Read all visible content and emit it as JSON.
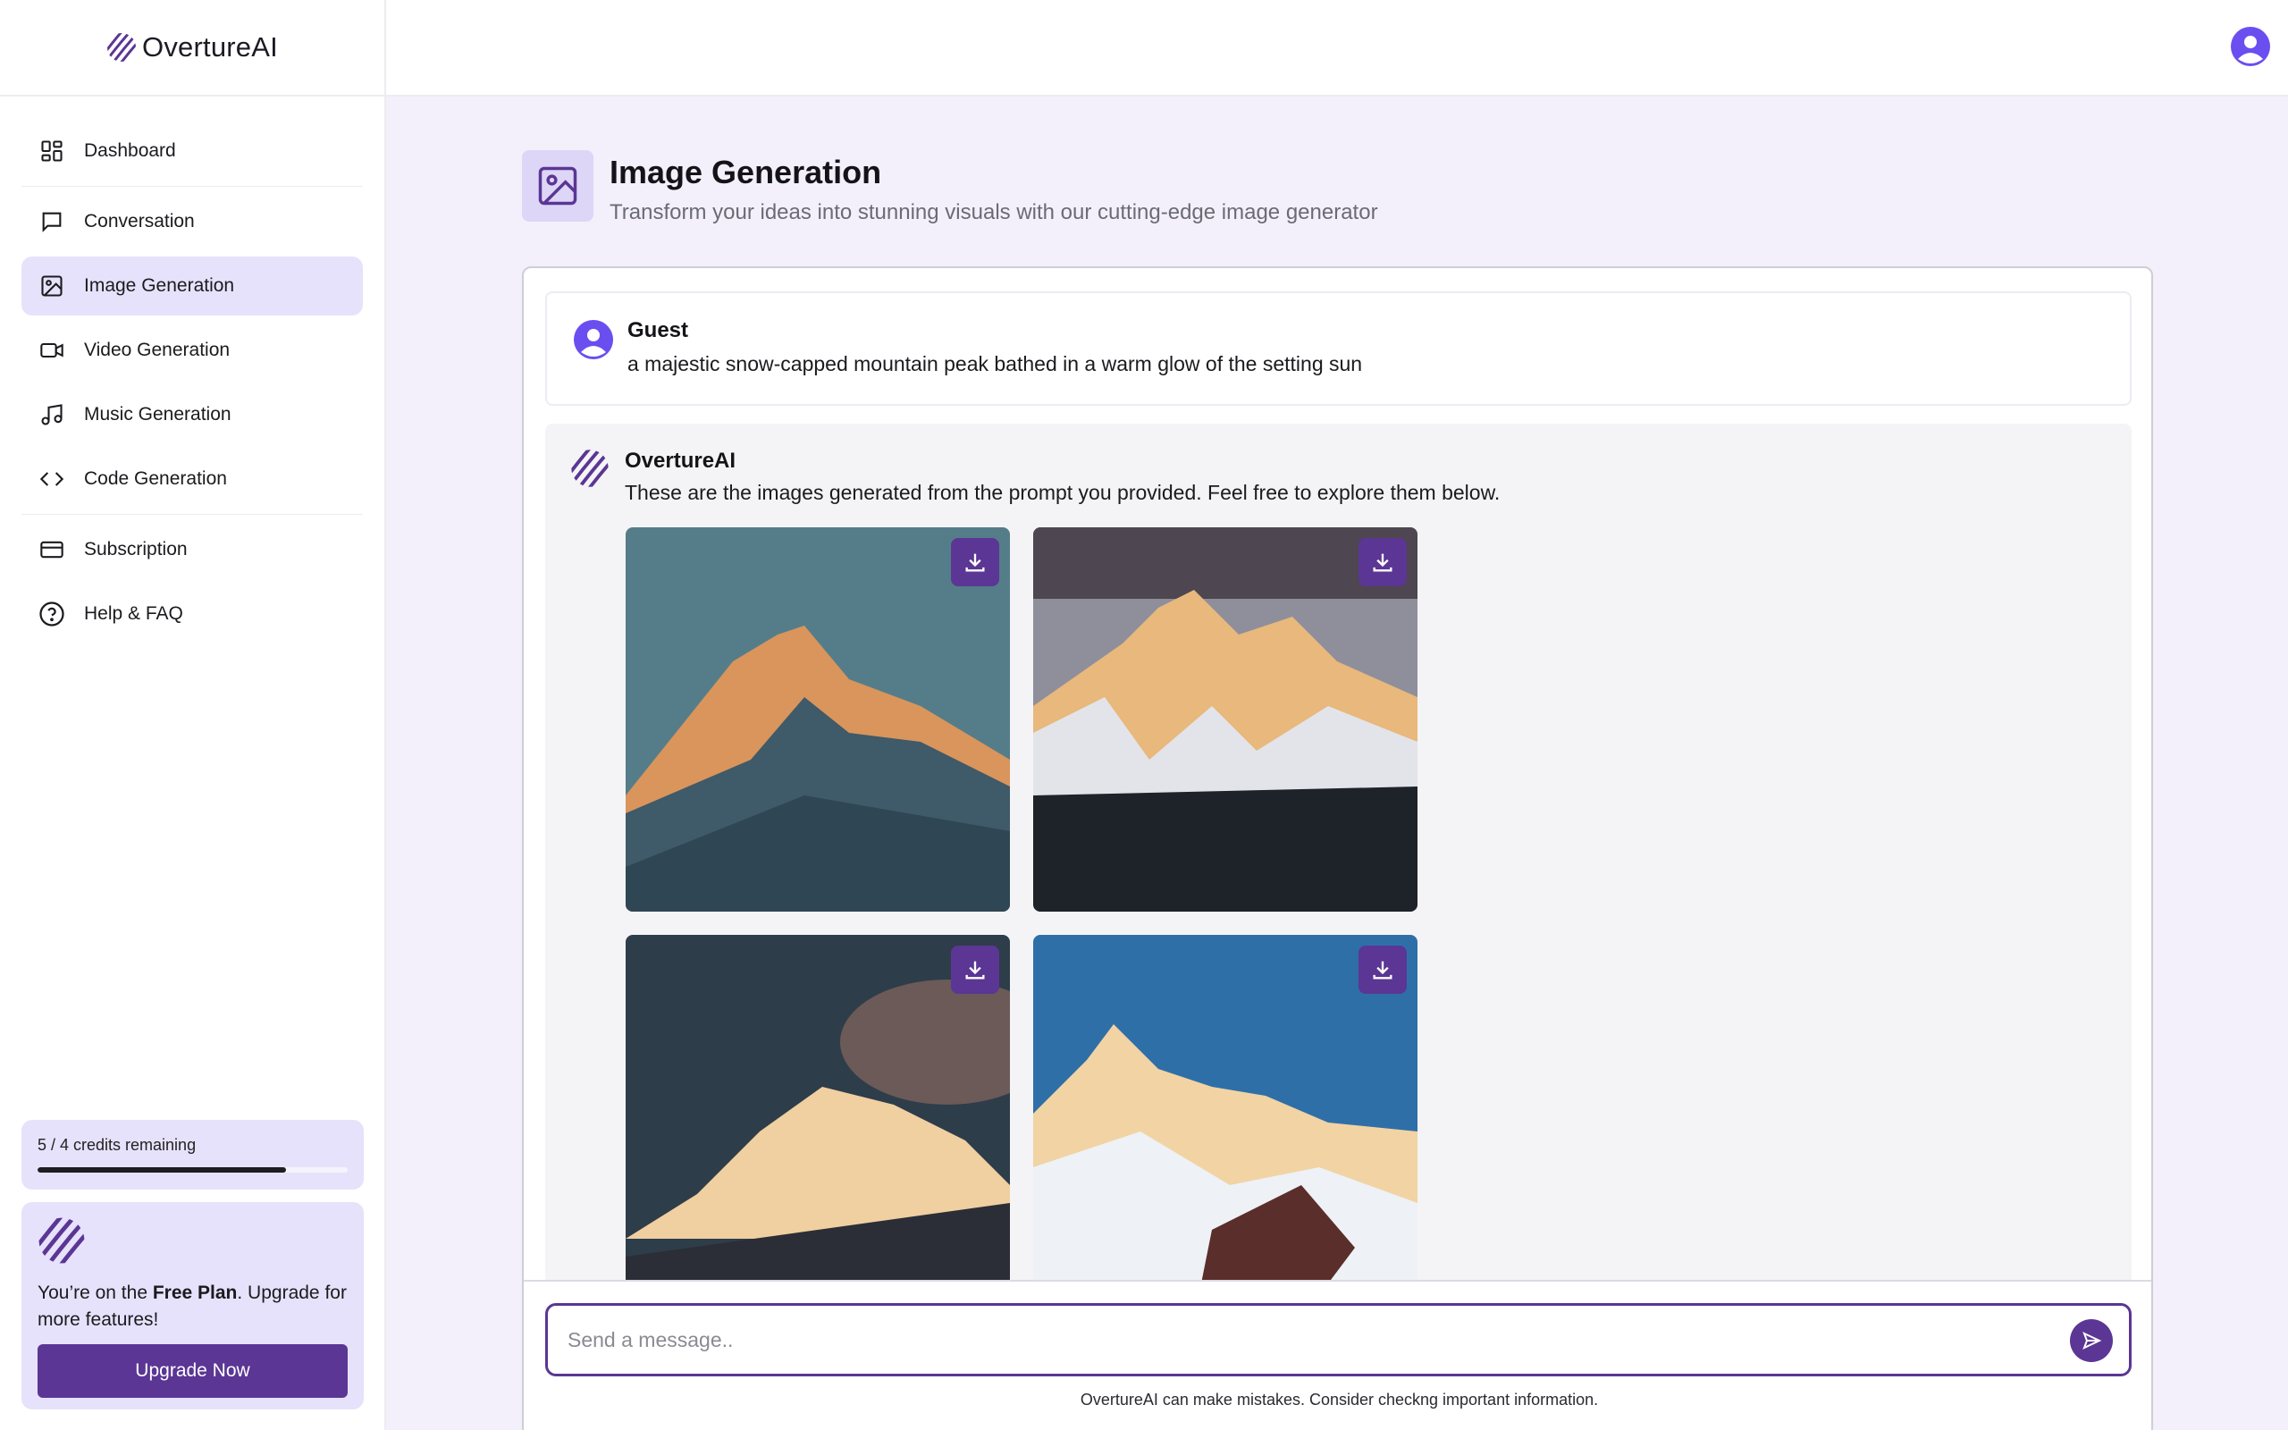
{
  "brand": {
    "name": "OvertureAI",
    "logo_icon": "overture-logo-icon",
    "brand_color": "#5b3694"
  },
  "sidebar": {
    "items": [
      {
        "label": "Dashboard",
        "icon": "dashboard-icon"
      },
      {
        "label": "Conversation",
        "icon": "chat-icon"
      },
      {
        "label": "Image Generation",
        "icon": "image-icon",
        "active": true
      },
      {
        "label": "Video Generation",
        "icon": "video-icon"
      },
      {
        "label": "Music Generation",
        "icon": "music-icon"
      },
      {
        "label": "Code Generation",
        "icon": "code-icon"
      },
      {
        "label": "Subscription",
        "icon": "card-icon"
      },
      {
        "label": "Help & FAQ",
        "icon": "help-icon"
      }
    ],
    "credits": {
      "text": "5 / 4 credits remaining",
      "progress_fraction": 0.8
    },
    "plan": {
      "prefix": "You’re on the ",
      "plan_name": "Free Plan",
      "suffix": ". Upgrade for more features!",
      "button_label": "Upgrade Now"
    }
  },
  "header": {
    "title": "Image Generation",
    "subtitle": "Transform your ideas into stunning visuals with our cutting-edge image generator"
  },
  "chat": {
    "user_message": {
      "name": "Guest",
      "text": "a majestic snow-capped mountain peak bathed in a warm glow of the setting sun"
    },
    "bot_message": {
      "name": "OvertureAI",
      "text": "These are the images generated from the prompt you provided. Feel free to explore them below."
    },
    "composer": {
      "placeholder": "Send a message..",
      "disclaimer": "OvertureAI can make mistakes. Consider checkng important information."
    }
  }
}
